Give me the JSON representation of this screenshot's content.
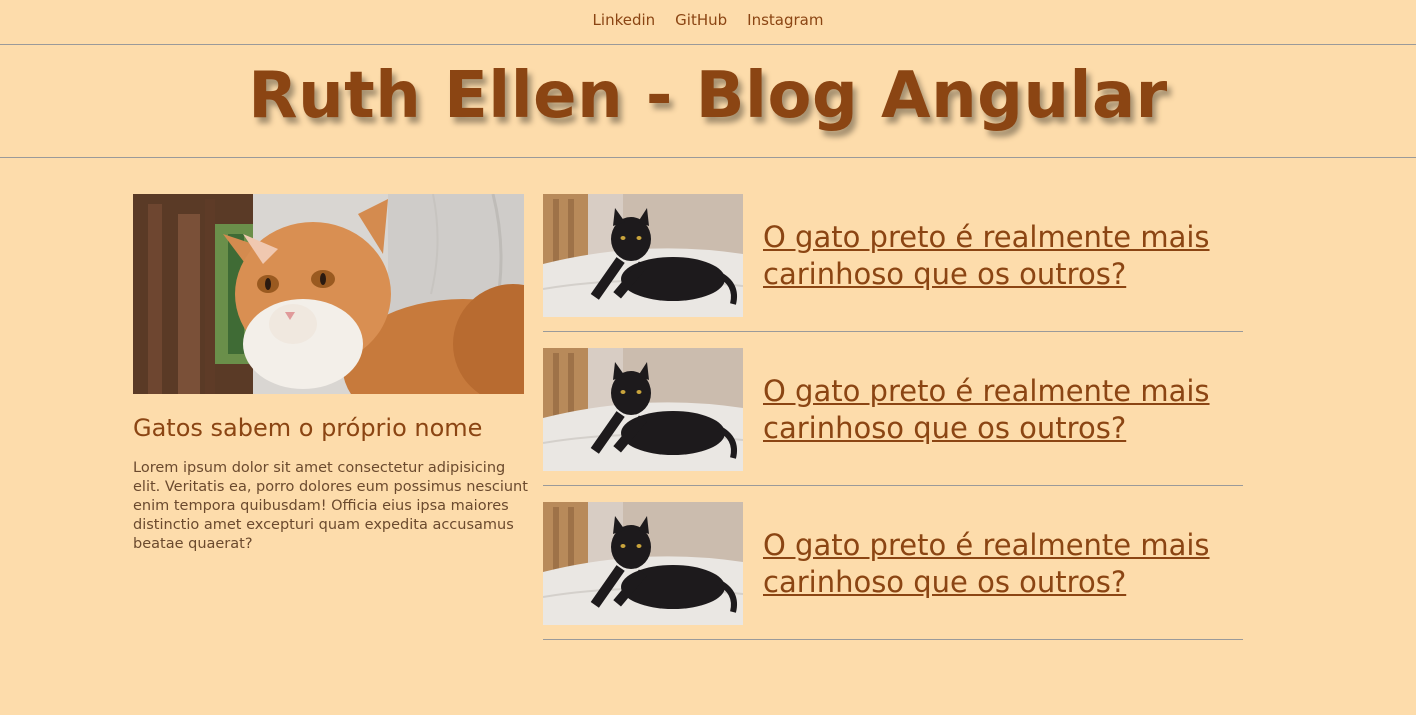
{
  "nav": {
    "links": [
      "Linkedin",
      "GitHub",
      "Instagram"
    ]
  },
  "header": {
    "title": "Ruth Ellen - Blog Angular"
  },
  "featured": {
    "title": "Gatos sabem o próprio nome",
    "text": "Lorem ipsum dolor sit amet consectetur adipisicing elit. Veritatis ea, porro dolores eum possimus nesciunt enim tempora quibusdam! Officia eius ipsa maiores distinctio amet excepturi quam expedita accusamus beatae quaerat?"
  },
  "posts": [
    {
      "title": "O gato preto é realmente mais carinhoso que os outros?"
    },
    {
      "title": "O gato preto é realmente mais carinhoso que os outros?"
    },
    {
      "title": "O gato preto é realmente mais carinhoso que os outros?"
    }
  ],
  "colors": {
    "background": "#FDDCAB",
    "accent": "#8B4513"
  }
}
